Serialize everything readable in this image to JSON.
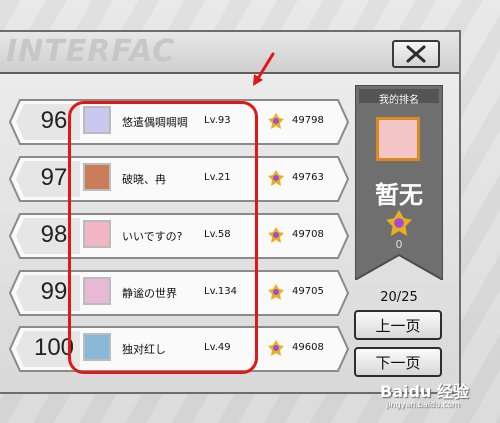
{
  "header": {
    "title": "INTERFAC",
    "close_icon": "close-icon"
  },
  "rankings": [
    {
      "rank": "96",
      "name": "悠遣偶啁啁啁",
      "level": "Lv.93",
      "score": "49798",
      "avatar_color": "#c9c9ef"
    },
    {
      "rank": "97",
      "name": "破晓、冉",
      "level": "Lv.21",
      "score": "49763",
      "avatar_color": "#c97d5b"
    },
    {
      "rank": "98",
      "name": "いいですの?",
      "level": "Lv.58",
      "score": "49708",
      "avatar_color": "#f2b5c3"
    },
    {
      "rank": "99",
      "name": "静谧の世界",
      "level": "Lv.134",
      "score": "49705",
      "avatar_color": "#e7b9d4"
    },
    {
      "rank": "100",
      "name": "独对红し",
      "level": "Lv.49",
      "score": "49608",
      "avatar_color": "#8ab8d8"
    }
  ],
  "my_rank": {
    "label": "我的排名",
    "rank_text": "暂无",
    "score": "0",
    "medal_icon": "medal-icon"
  },
  "pagination": {
    "page_text": "20/25",
    "prev_label": "上一页",
    "next_label": "下一页"
  },
  "annotation": {
    "highlight_color": "#e21818"
  },
  "watermark": {
    "text": "Baidu 经验",
    "url": "jingyan.baidu.com"
  }
}
